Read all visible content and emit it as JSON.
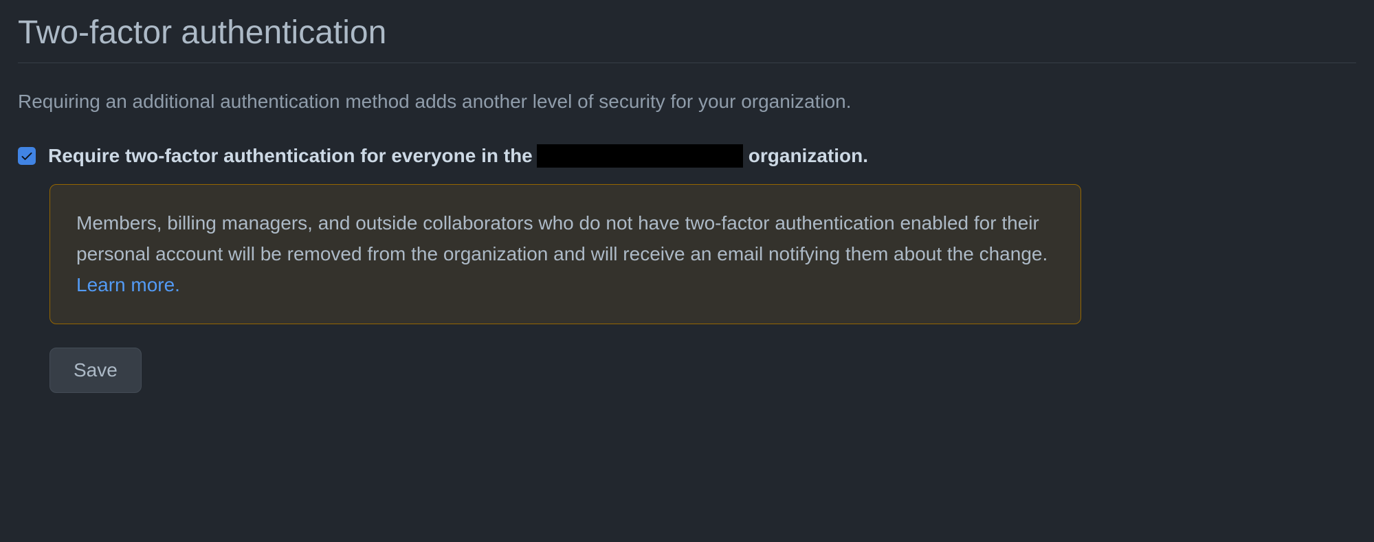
{
  "section": {
    "title": "Two-factor authentication",
    "description": "Requiring an additional authentication method adds another level of security for your organization."
  },
  "checkbox": {
    "checked": true,
    "label_prefix": "Require two-factor authentication for everyone in the",
    "label_suffix": "organization."
  },
  "warning": {
    "text": "Members, billing managers, and outside collaborators who do not have two-factor authentication enabled for their personal account will be removed from the organization and will receive an email notifying them about the change. ",
    "link_text": "Learn more."
  },
  "buttons": {
    "save": "Save"
  }
}
